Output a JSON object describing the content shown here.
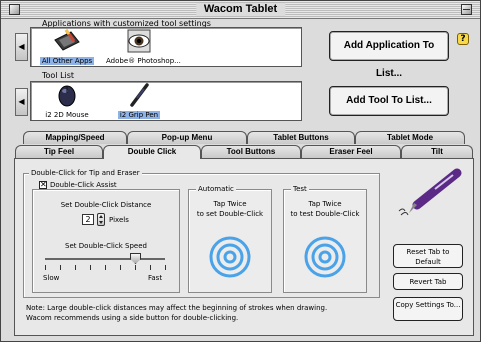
{
  "window": {
    "title": "Wacom Tablet"
  },
  "applications": {
    "label": "Applications with customized tool settings",
    "items": [
      {
        "label": "All Other Apps",
        "icon": "tablet-app-icon",
        "selected": true
      },
      {
        "label": "Adobe® Photoshop...",
        "icon": "photoshop-eye-icon",
        "selected": false
      }
    ]
  },
  "tools": {
    "label": "Tool List",
    "items": [
      {
        "label": "i2 2D Mouse",
        "icon": "mouse-icon",
        "selected": false
      },
      {
        "label": "i2 Grip Pen",
        "icon": "pen-icon",
        "selected": true
      }
    ]
  },
  "buttons": {
    "add_application": "Add Application To List...",
    "add_tool": "Add Tool To List...",
    "help": "?"
  },
  "tabs": {
    "back_row": [
      "Mapping/Speed",
      "Pop-up Menu",
      "Tablet Buttons",
      "Tablet Mode"
    ],
    "front_row": [
      "Tip Feel",
      "Double Click",
      "Tool Buttons",
      "Eraser Feel",
      "Tilt"
    ],
    "active": "Double Click"
  },
  "double_click": {
    "group_label": "Double-Click for Tip and Eraser",
    "assist_label": "Double-Click Assist",
    "assist_checked": true,
    "distance_label": "Set Double-Click Distance",
    "distance_value": "2",
    "distance_unit": "Pixels",
    "speed_label": "Set Double-Click Speed",
    "speed_slow": "Slow",
    "speed_fast": "Fast",
    "speed_level": 0.75,
    "automatic_label": "Automatic",
    "automatic_text": "Tap Twice\nto set Double-Click",
    "test_label": "Test",
    "test_text": "Tap Twice\nto test Double-Click"
  },
  "side_buttons": {
    "reset": "Reset Tab to Default",
    "revert": "Revert Tab",
    "copy": "Copy Settings To..."
  },
  "note": {
    "line1": "Note:  Large double-click distances may affect the beginning of strokes when drawing.",
    "line2": "Wacom recommends using a side button for double-clicking."
  },
  "colors": {
    "selection": "#8fb2e6",
    "target_ring": "#4aa3e8",
    "pen_purple": "#5b2a86"
  }
}
